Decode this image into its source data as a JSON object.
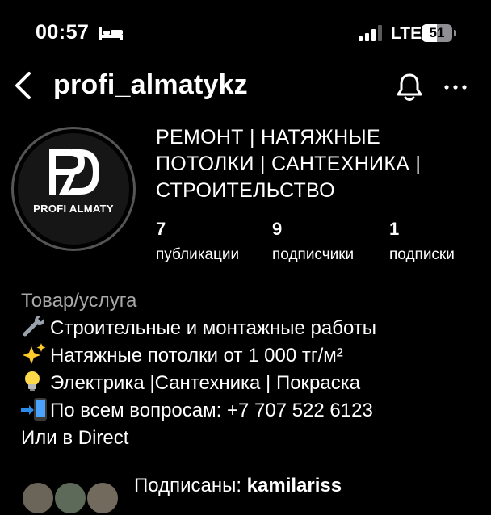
{
  "status_bar": {
    "time": "00:57",
    "network": "LTE",
    "battery_level": "51",
    "battery_fraction": 0.51,
    "icons": [
      "bed-icon",
      "signal-icon"
    ]
  },
  "nav": {
    "username": "profi_almatykz",
    "icons": [
      "back-chevron-icon",
      "bell-icon",
      "more-icon"
    ]
  },
  "avatar": {
    "logo_text": "PROFI ALMATY"
  },
  "profile": {
    "name_lines": [
      "РЕМОНТ | НАТЯЖНЫЕ",
      "ПОТОЛКИ | САНТЕХНИКА |",
      "СТРОИТЕЛЬСТВО"
    ],
    "stats": [
      {
        "value": "7",
        "label": "публикации"
      },
      {
        "value": "9",
        "label": "подписчики"
      },
      {
        "value": "1",
        "label": "подписки"
      }
    ]
  },
  "bio": {
    "category": "Товар/услуга",
    "lines": [
      {
        "icon": "wrench-icon",
        "text": "Строительные и монтажные работы"
      },
      {
        "icon": "sparkles-icon",
        "text": "Натяжные потолки от 1 000 тг/м²"
      },
      {
        "icon": "light-bulb-icon",
        "text": "Электрика |Сантехника | Покраска"
      },
      {
        "icon": "phone-arrow-icon",
        "text": "По всем вопросам: +7 707 522 6123"
      },
      {
        "icon": "",
        "text": "Или в Direct"
      }
    ]
  },
  "followers_preview": {
    "prefix": "Подписаны: ",
    "name": "kamilariss"
  }
}
